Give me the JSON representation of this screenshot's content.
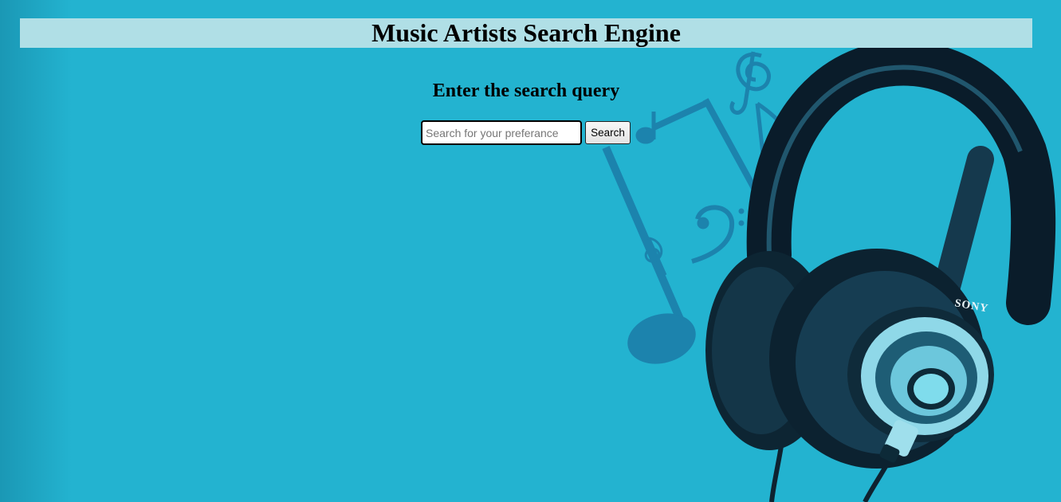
{
  "header": {
    "title": "Music Artists Search Engine"
  },
  "main": {
    "subheading": "Enter the search query",
    "search": {
      "value": "",
      "placeholder": "Search for your preferance",
      "button_label": "Search"
    },
    "decoration": {
      "brand_text": "SONY"
    }
  },
  "colors": {
    "background": "#23b3d0",
    "header_bar": "#b0dfe6"
  }
}
